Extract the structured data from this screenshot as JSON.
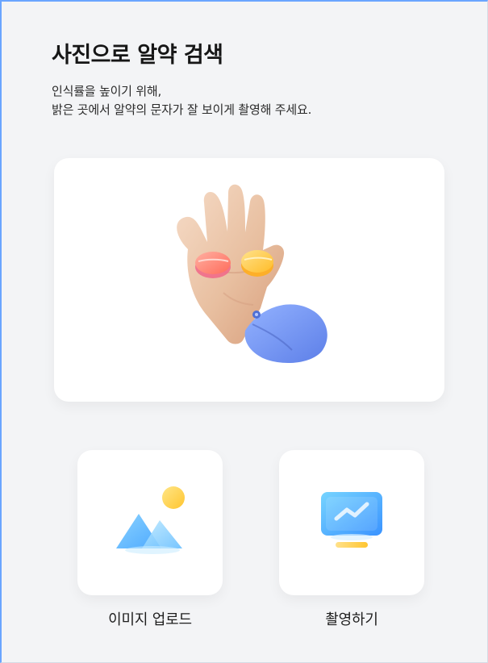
{
  "header": {
    "title": "사진으로 알약 검색",
    "subtitle_lines": [
      "인식률을 높이기 위해,",
      "밝은 곳에서 알약의 문자가 잘 보이게 촬영해 주세요."
    ]
  },
  "hero": {
    "illustration_icon": "hand-with-pills-icon"
  },
  "actions": [
    {
      "label": "이미지 업로드",
      "icon": "image-upload-icon"
    },
    {
      "label": "촬영하기",
      "icon": "camera-monitor-icon"
    }
  ],
  "colors": {
    "accent": "#4da3ff",
    "background": "#f3f4f6",
    "card": "#ffffff",
    "pill_red": "#ff6b5a",
    "pill_yellow": "#ffc533"
  }
}
